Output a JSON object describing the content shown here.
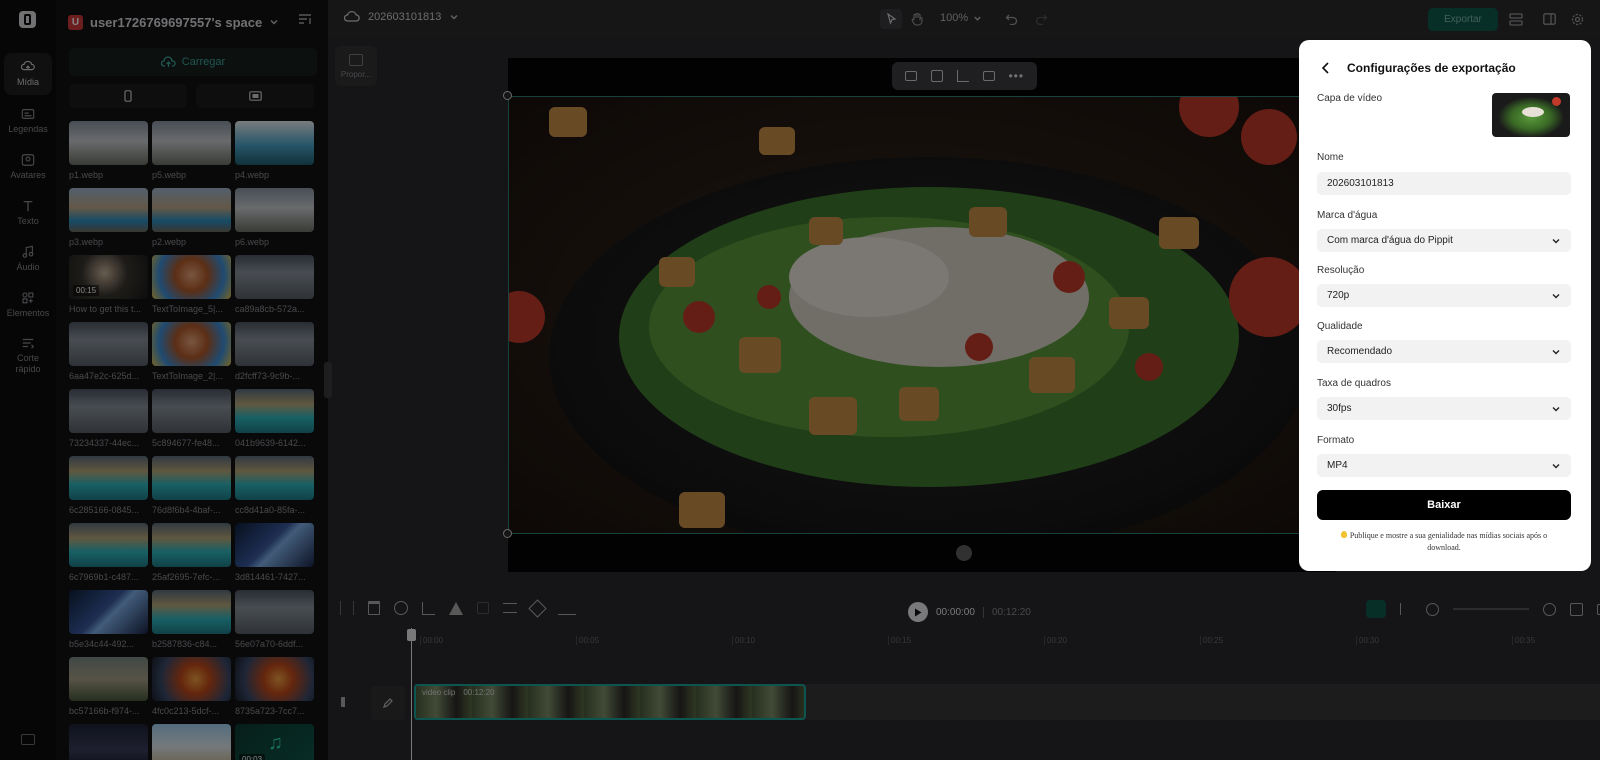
{
  "workspace": {
    "badge": "U",
    "name": "user1726769697557's space"
  },
  "rail": [
    {
      "label": "Mídia",
      "icon": "cloud-media-icon",
      "active": true
    },
    {
      "label": "Legendas",
      "icon": "captions-icon"
    },
    {
      "label": "Avatares",
      "icon": "avatar-icon"
    },
    {
      "label": "Texto",
      "icon": "text-icon"
    },
    {
      "label": "Áudio",
      "icon": "music-note-icon"
    },
    {
      "label": "Elementos",
      "icon": "elements-icon"
    },
    {
      "label": "Corte rápido",
      "icon": "quick-cut-icon"
    }
  ],
  "media": {
    "upload_label": "Carregar",
    "items": [
      {
        "name": "p1.webp",
        "theme": "house"
      },
      {
        "name": "p5.webp",
        "theme": "house"
      },
      {
        "name": "p4.webp",
        "theme": "blueprint"
      },
      {
        "name": "p3.webp",
        "theme": "pool"
      },
      {
        "name": "p2.webp",
        "theme": "pool"
      },
      {
        "name": "p6.webp",
        "theme": "house"
      },
      {
        "name": "How to get this t...",
        "theme": "person",
        "duration": "00:15"
      },
      {
        "name": "TextToImage_5|...",
        "theme": "cartoon"
      },
      {
        "name": "ca89a8cb-572a...",
        "theme": "storm"
      },
      {
        "name": "6aa47e2c-625d...",
        "theme": "storm"
      },
      {
        "name": "TextToImage_2|...",
        "theme": "cartoon"
      },
      {
        "name": "d2fcff73-9c9b-...",
        "theme": "storm"
      },
      {
        "name": "73234337-44ec...",
        "theme": "storm"
      },
      {
        "name": "5c894677-fe48...",
        "theme": "storm"
      },
      {
        "name": "041b9639-6142...",
        "theme": "island"
      },
      {
        "name": "6c285166-0845...",
        "theme": "island"
      },
      {
        "name": "76d8f6b4-4baf-...",
        "theme": "island"
      },
      {
        "name": "cc8d41a0-85fa-...",
        "theme": "island"
      },
      {
        "name": "6c7969b1-c487...",
        "theme": "island"
      },
      {
        "name": "25af2695-7efc-...",
        "theme": "island"
      },
      {
        "name": "3d814461-7427...",
        "theme": "neon"
      },
      {
        "name": "b5e34c44-492...",
        "theme": "neon"
      },
      {
        "name": "b2587836-c84...",
        "theme": "island"
      },
      {
        "name": "56e07a70-6ddf...",
        "theme": "storm"
      },
      {
        "name": "bc57166b-f974-...",
        "theme": "ruins"
      },
      {
        "name": "4fc0c213-5dcf-...",
        "theme": "fire"
      },
      {
        "name": "8735a723-7cc7...",
        "theme": "fire"
      },
      {
        "name": "",
        "theme": "night"
      },
      {
        "name": "",
        "theme": "beach"
      },
      {
        "name": "",
        "theme": "audio",
        "duration": "00:03"
      }
    ]
  },
  "project": {
    "name": "202603101813"
  },
  "toolbar": {
    "zoom": "100%",
    "export_label": "Exportar"
  },
  "canvas": {
    "ratio_label": "Propor..."
  },
  "timeline": {
    "current": "00:00:00",
    "total": "00:12:20",
    "ticks": [
      "00:00",
      "00:05",
      "00:10",
      "00:15",
      "00:20",
      "00:25",
      "00:30",
      "00:35"
    ],
    "clip_label": "video clip",
    "clip_duration": "00:12:20"
  },
  "export_dialog": {
    "title": "Configurações de exportação",
    "cover_label": "Capa de vídeo",
    "name_label": "Nome",
    "name_value": "202603101813",
    "watermark_label": "Marca d'água",
    "watermark_value": "Com marca d'água do Pippit",
    "resolution_label": "Resolução",
    "resolution_value": "720p",
    "quality_label": "Qualidade",
    "quality_value": "Recomendado",
    "fps_label": "Taxa de quadros",
    "fps_value": "30fps",
    "format_label": "Formato",
    "format_value": "MP4",
    "download_label": "Baixar",
    "note": "Publique e mostre a sua genialidade nas mídias sociais após o download."
  }
}
